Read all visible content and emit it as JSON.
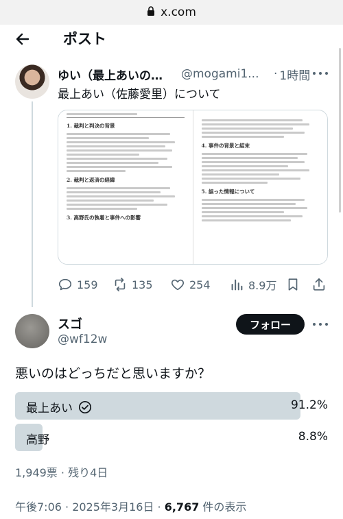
{
  "browser": {
    "url": "x.com"
  },
  "header": {
    "title": "ポスト"
  },
  "quoted_post": {
    "name": "ゆい（最上あいの…",
    "handle": "@mogami1...",
    "separator": "·",
    "time": "1時間",
    "text": "最上あい（佐藤愛里）について",
    "image": {
      "left_page": {
        "sections": [
          "1. 裁判と判決の背景",
          "2. 裁判と返済の経緯",
          "3. 高野氏の執着と事件への影響"
        ]
      },
      "right_page": {
        "sections": [
          "4. 事件の背景と結末",
          "5. 誤った情報について"
        ]
      }
    },
    "stats": {
      "replies": "159",
      "reposts": "135",
      "likes": "254",
      "views": "8.9万"
    }
  },
  "reply_post": {
    "name": "スゴ",
    "handle": "@wf12w",
    "follow_label": "フォロー",
    "question": "悪いのはどっちだと思いますか？",
    "poll": {
      "options": [
        {
          "label": "最上あい",
          "percent": "91.2%",
          "fraction": 0.912,
          "selected": true
        },
        {
          "label": "高野",
          "percent": "8.8%",
          "fraction": 0.088,
          "selected": false
        }
      ],
      "votes_and_remaining": "1,949票 · 残り4日"
    },
    "timestamp": "午後7:06 · 2025年3月16日 · ",
    "views_count": "6,767",
    "views_suffix": " 件の表示"
  },
  "colors": {
    "poll_bar": "#cfd9de",
    "text": "#0f1419",
    "secondary": "#536471"
  }
}
